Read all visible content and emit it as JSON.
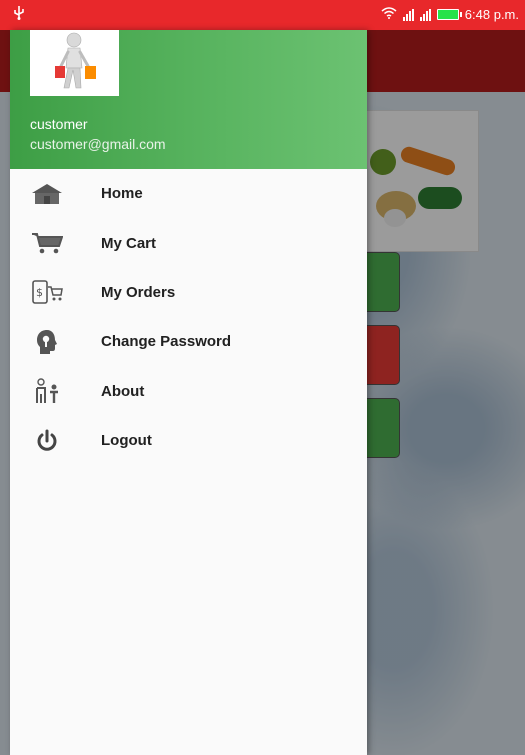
{
  "status_bar": {
    "usb_icon": "usb-icon",
    "time": "6:48 p.m.",
    "colors": {
      "background": "#e8282b",
      "battery": "#27e24a"
    }
  },
  "drawer": {
    "header": {
      "avatar_icon": "shopper-figure-icon",
      "user_name": "customer",
      "user_email": "customer@gmail.com",
      "background_color": "#4caf50"
    },
    "items": [
      {
        "label": "Home",
        "icon": "home-icon"
      },
      {
        "label": "My Cart",
        "icon": "cart-icon"
      },
      {
        "label": "My Orders",
        "icon": "orders-icon"
      },
      {
        "label": "Change Password",
        "icon": "key-head-icon"
      },
      {
        "label": "About",
        "icon": "about-icon"
      },
      {
        "label": "Logout",
        "icon": "power-icon"
      }
    ]
  },
  "background_app": {
    "toolbar_color": "#b21c1c",
    "button_colors": [
      "#4caf50",
      "#e53935",
      "#4caf50"
    ]
  }
}
